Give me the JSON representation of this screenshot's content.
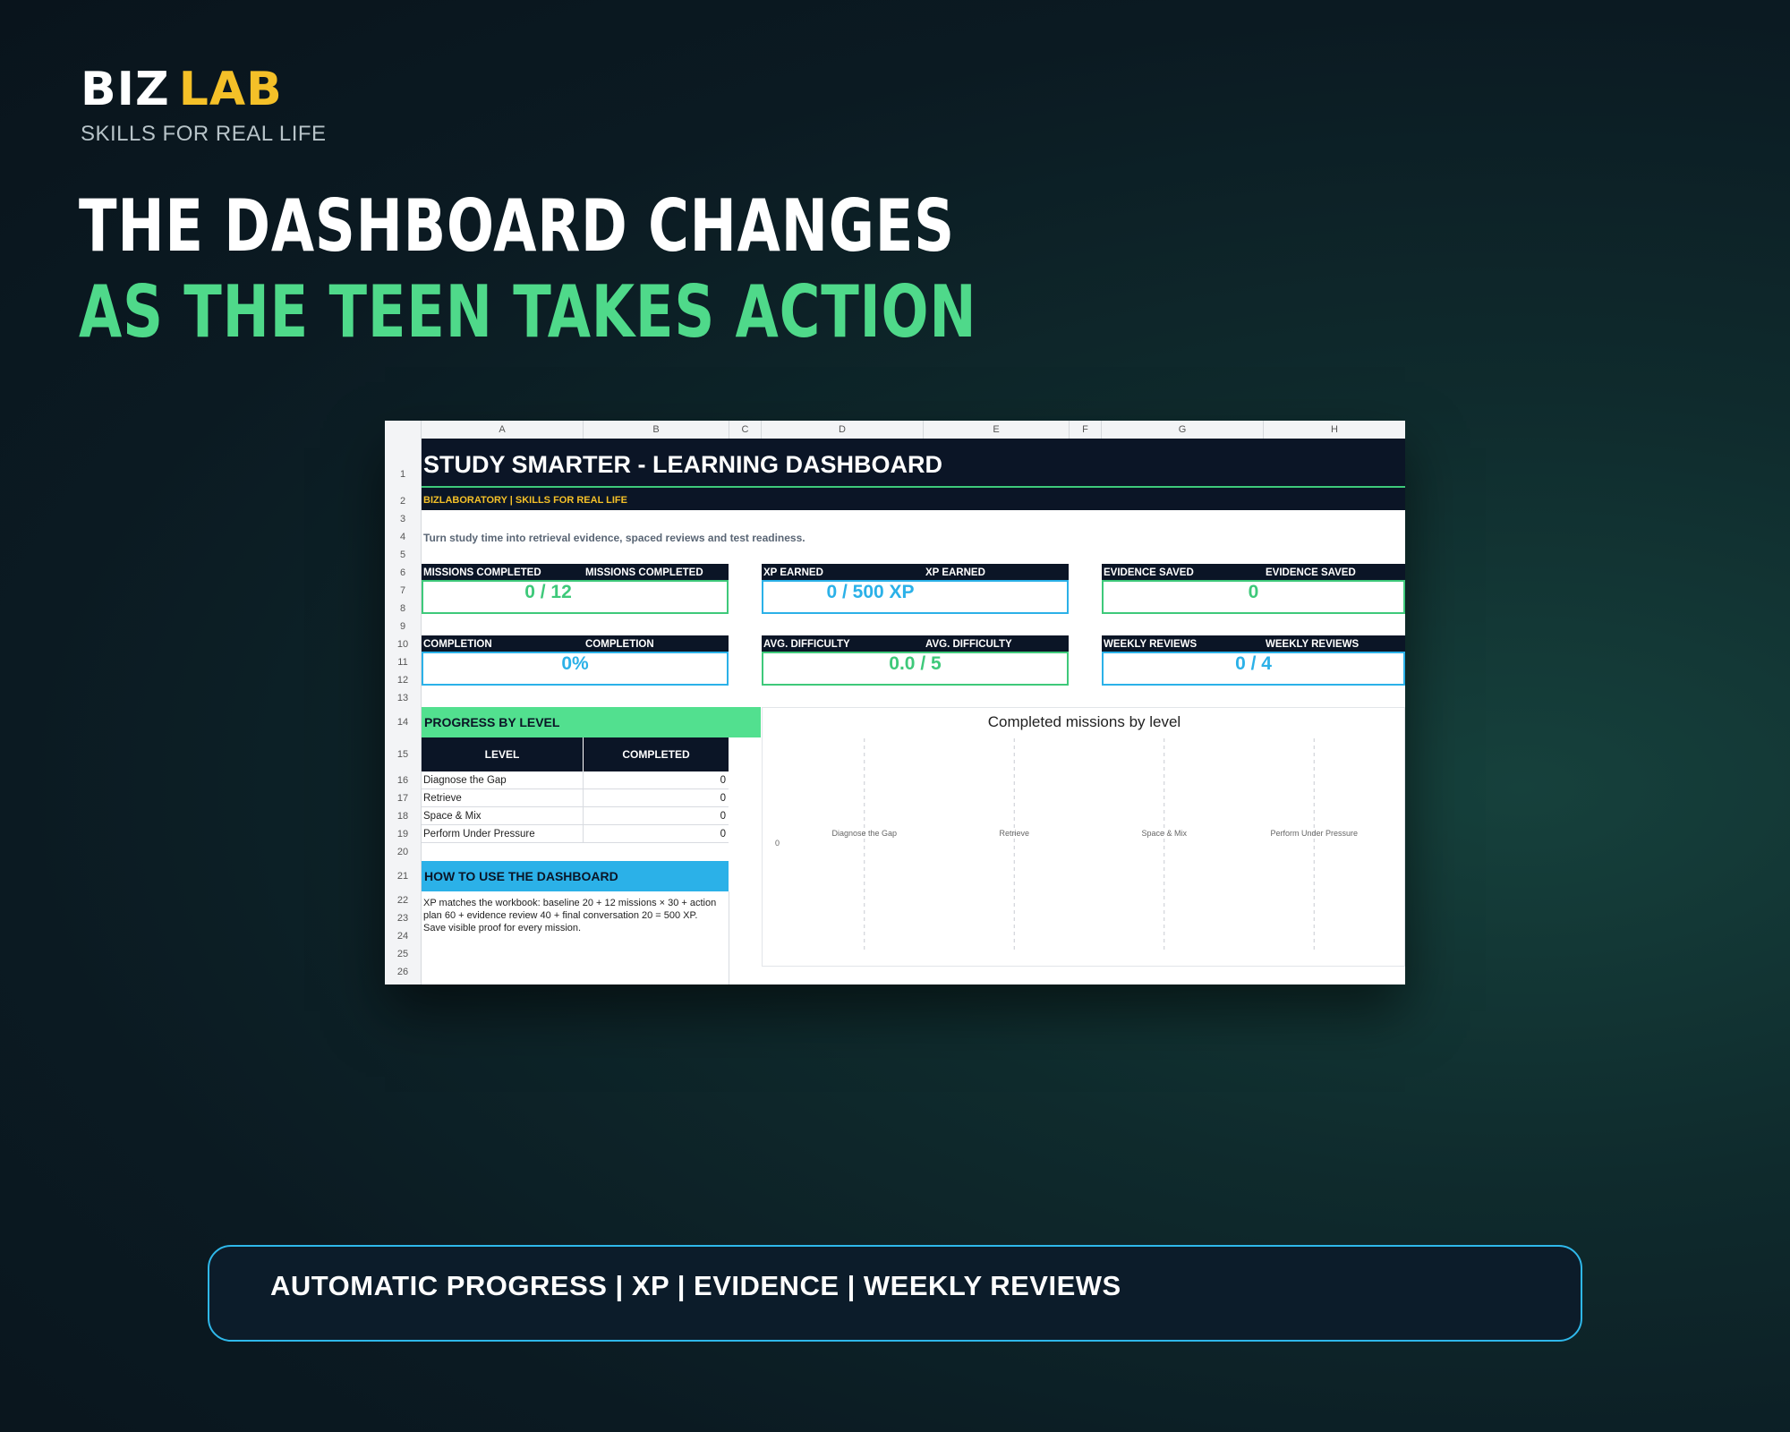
{
  "brand": {
    "biz": "BIZ",
    "lab": "LAB",
    "tagline": "SKILLS FOR REAL LIFE"
  },
  "headline": {
    "line1": "THE DASHBOARD CHANGES",
    "line2": "AS THE TEEN TAKES ACTION"
  },
  "sheet": {
    "columns": [
      "A",
      "B",
      "C",
      "D",
      "E",
      "F",
      "G",
      "H"
    ],
    "rows": [
      "1",
      "2",
      "3",
      "4",
      "5",
      "6",
      "7",
      "8",
      "9",
      "10",
      "11",
      "12",
      "13",
      "14",
      "15",
      "16",
      "17",
      "18",
      "19",
      "20",
      "21",
      "22",
      "23",
      "24",
      "25",
      "26"
    ],
    "title": "STUDY SMARTER - LEARNING DASHBOARD",
    "subtitle": "BIZLABORATORY  |  SKILLS FOR REAL LIFE",
    "intro": "Turn study time into retrieval evidence, spaced reviews and test readiness.",
    "kpis": [
      {
        "label": "MISSIONS COMPLETED",
        "label2": "MISSIONS COMPLETED",
        "value": "0 / 12",
        "color": "#3ec97a"
      },
      {
        "label": "XP EARNED",
        "label2": "XP EARNED",
        "value": "0 / 500 XP",
        "color": "#2bb1e8"
      },
      {
        "label": "EVIDENCE SAVED",
        "label2": "EVIDENCE SAVED",
        "value": "0",
        "color": "#3ec97a"
      },
      {
        "label": "COMPLETION",
        "label2": "COMPLETION",
        "value": "0%",
        "color": "#2bb1e8"
      },
      {
        "label": "AVG. DIFFICULTY",
        "label2": "AVG. DIFFICULTY",
        "value": "0.0 / 5",
        "color": "#3ec97a"
      },
      {
        "label": "WEEKLY REVIEWS",
        "label2": "WEEKLY REVIEWS",
        "value": "0 / 4",
        "color": "#2bb1e8"
      }
    ],
    "progress_section": "PROGRESS BY LEVEL",
    "table": {
      "headers": [
        "LEVEL",
        "COMPLETED"
      ],
      "rows": [
        {
          "level": "Diagnose the Gap",
          "completed": "0"
        },
        {
          "level": "Retrieve",
          "completed": "0"
        },
        {
          "level": "Space & Mix",
          "completed": "0"
        },
        {
          "level": "Perform Under Pressure",
          "completed": "0"
        }
      ]
    },
    "howto_section": "HOW TO USE THE DASHBOARD",
    "howto_text": "XP matches the workbook: baseline 20 + 12 missions × 30 + action plan 60 + evidence review 40 + final conversation 20 = 500 XP. Save visible proof for every mission.",
    "colors": {
      "navy": "#0b1526",
      "green": "#3ec97a",
      "blue": "#2bb1e8",
      "yellow": "#f4c028",
      "section_green": "#52e08f"
    }
  },
  "chart_data": {
    "type": "bar",
    "title": "Completed missions by level",
    "categories": [
      "Diagnose the Gap",
      "Retrieve",
      "Space & Mix",
      "Perform Under Pressure"
    ],
    "values": [
      0,
      0,
      0,
      0
    ],
    "y_tick": "0",
    "grid": "vertical dashed"
  },
  "footer": {
    "text": "AUTOMATIC PROGRESS  |  XP  |  EVIDENCE  |  WEEKLY REVIEWS"
  }
}
